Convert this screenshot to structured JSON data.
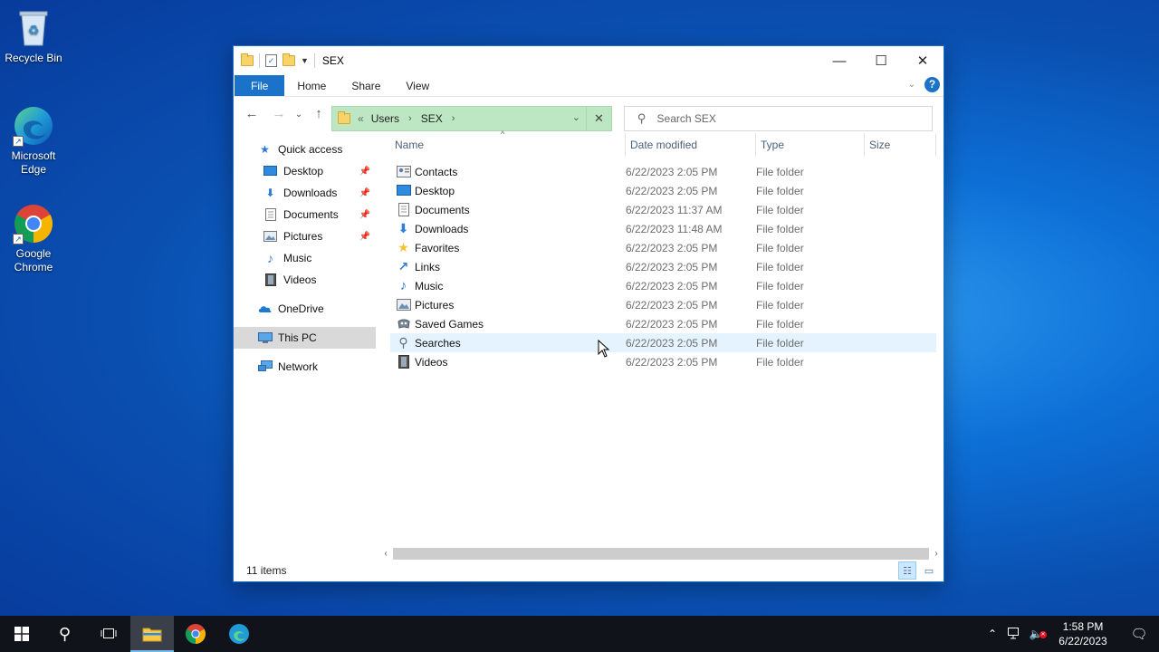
{
  "desktop": {
    "icons": [
      {
        "label": "Recycle Bin",
        "icon": "recycle-bin-icon"
      },
      {
        "label": "Microsoft Edge",
        "icon": "edge-icon"
      },
      {
        "label": "Google Chrome",
        "icon": "chrome-icon"
      }
    ]
  },
  "window": {
    "title": "SEX",
    "ribbon_tabs": [
      "File",
      "Home",
      "Share",
      "View"
    ],
    "help": "?",
    "address": {
      "prefix": "«",
      "crumbs": [
        "Users",
        "SEX"
      ]
    },
    "search_placeholder": "Search SEX",
    "nav": [
      {
        "label": "Quick access",
        "icon": "star-icon",
        "pinned": false
      },
      {
        "label": "Desktop",
        "icon": "desktop-icon",
        "pinned": true
      },
      {
        "label": "Downloads",
        "icon": "downloads-icon",
        "pinned": true
      },
      {
        "label": "Documents",
        "icon": "documents-icon",
        "pinned": true
      },
      {
        "label": "Pictures",
        "icon": "pictures-icon",
        "pinned": true
      },
      {
        "label": "Music",
        "icon": "music-icon",
        "pinned": false
      },
      {
        "label": "Videos",
        "icon": "videos-icon",
        "pinned": false
      },
      {
        "label": "OneDrive",
        "icon": "cloud-icon",
        "pinned": false
      },
      {
        "label": "This PC",
        "icon": "computer-icon",
        "pinned": false,
        "selected": true
      },
      {
        "label": "Network",
        "icon": "network-icon",
        "pinned": false
      }
    ],
    "columns": [
      "Name",
      "Date modified",
      "Type",
      "Size"
    ],
    "files": [
      {
        "name": "Contacts",
        "date": "6/22/2023 2:05 PM",
        "type": "File folder",
        "icon": "contacts-icon"
      },
      {
        "name": "Desktop",
        "date": "6/22/2023 2:05 PM",
        "type": "File folder",
        "icon": "desktop-icon"
      },
      {
        "name": "Documents",
        "date": "6/22/2023 11:37 AM",
        "type": "File folder",
        "icon": "documents-icon"
      },
      {
        "name": "Downloads",
        "date": "6/22/2023 11:48 AM",
        "type": "File folder",
        "icon": "downloads-icon"
      },
      {
        "name": "Favorites",
        "date": "6/22/2023 2:05 PM",
        "type": "File folder",
        "icon": "star-icon"
      },
      {
        "name": "Links",
        "date": "6/22/2023 2:05 PM",
        "type": "File folder",
        "icon": "links-icon"
      },
      {
        "name": "Music",
        "date": "6/22/2023 2:05 PM",
        "type": "File folder",
        "icon": "music-icon"
      },
      {
        "name": "Pictures",
        "date": "6/22/2023 2:05 PM",
        "type": "File folder",
        "icon": "pictures-icon"
      },
      {
        "name": "Saved Games",
        "date": "6/22/2023 2:05 PM",
        "type": "File folder",
        "icon": "saved-games-icon"
      },
      {
        "name": "Searches",
        "date": "6/22/2023 2:05 PM",
        "type": "File folder",
        "icon": "search-icon",
        "hover": true
      },
      {
        "name": "Videos",
        "date": "6/22/2023 2:05 PM",
        "type": "File folder",
        "icon": "videos-icon"
      }
    ],
    "status": "11 items"
  },
  "taskbar": {
    "time": "1:58 PM",
    "date": "6/22/2023"
  },
  "colors": {
    "accent": "#1a73c9",
    "address_bg": "#bde6c2",
    "hover_row": "#e5f3ff",
    "taskbar": "#10131a"
  }
}
